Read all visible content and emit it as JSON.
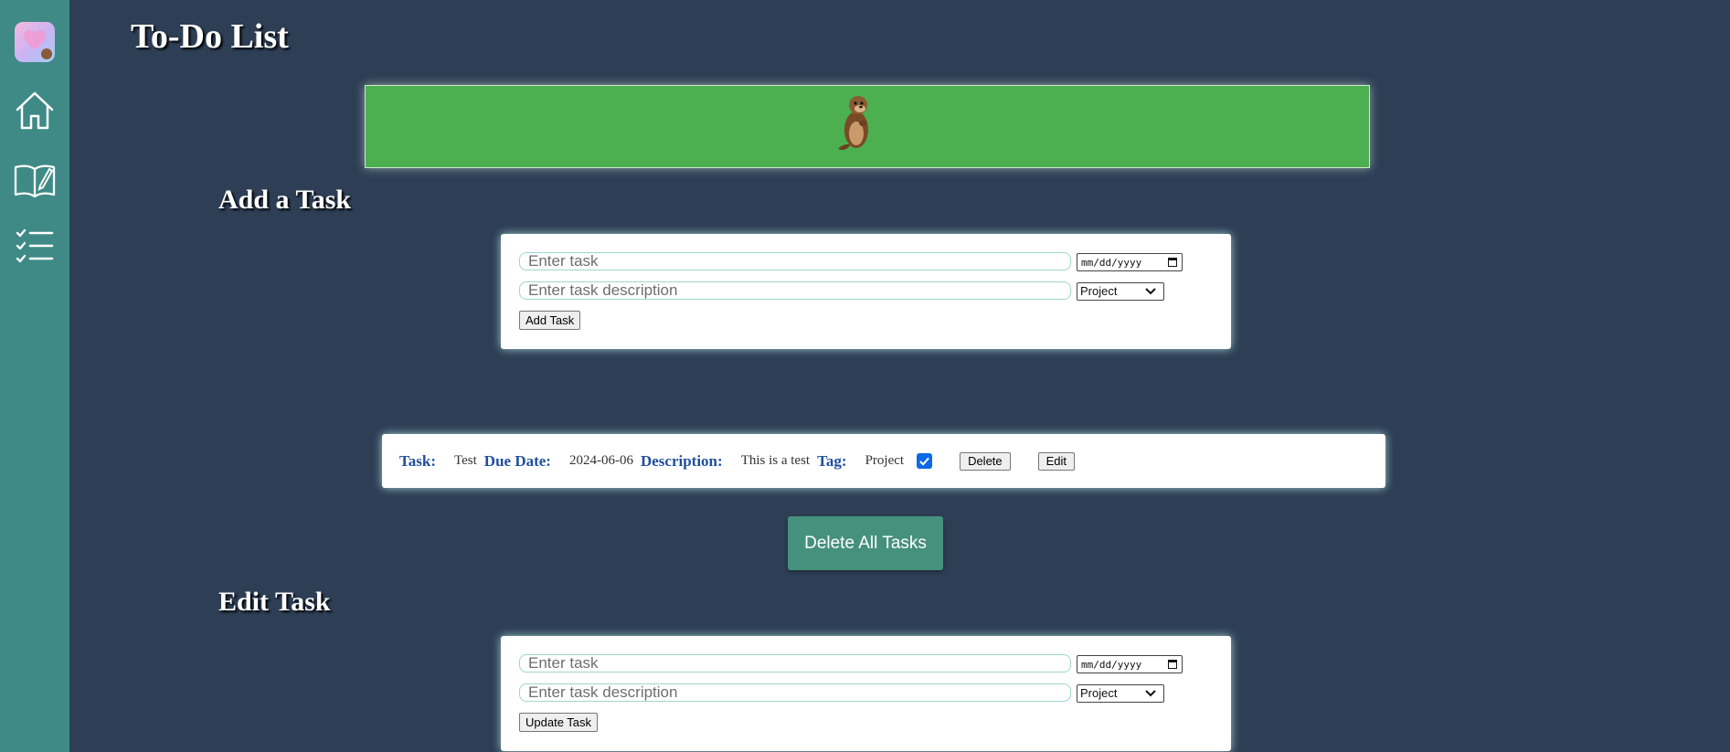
{
  "page": {
    "title": "To-Do List"
  },
  "sidebar": {
    "items": [
      {
        "icon": "home-icon"
      },
      {
        "icon": "book-icon"
      },
      {
        "icon": "checklist-icon"
      }
    ]
  },
  "add_section": {
    "title": "Add a Task",
    "task_placeholder": "Enter task",
    "description_placeholder": "Enter task description",
    "date_placeholder": "mm/dd/yyyy",
    "tag_selected": "Project",
    "submit_label": "Add Task"
  },
  "task_list": {
    "items": [
      {
        "task_label": "Task:",
        "task": "Test",
        "due_label": "Due Date:",
        "due": "2024-06-06",
        "description_label": "Description:",
        "description": "This is a test",
        "tag_label": "Tag:",
        "tag": "Project",
        "completed": true,
        "delete_label": "Delete",
        "edit_label": "Edit"
      }
    ]
  },
  "delete_all_label": "Delete All Tasks",
  "edit_section": {
    "title": "Edit Task",
    "task_placeholder": "Enter task",
    "description_placeholder": "Enter task description",
    "date_placeholder": "mm/dd/yyyy",
    "tag_selected": "Project",
    "submit_label": "Update Task"
  },
  "colors": {
    "background": "#2d3e55",
    "sidebar": "#3f8a86",
    "banner": "#4caf50",
    "label_blue": "#1f4f9e",
    "delete_all_button": "#46917d",
    "checkbox": "#0b6ae6"
  }
}
